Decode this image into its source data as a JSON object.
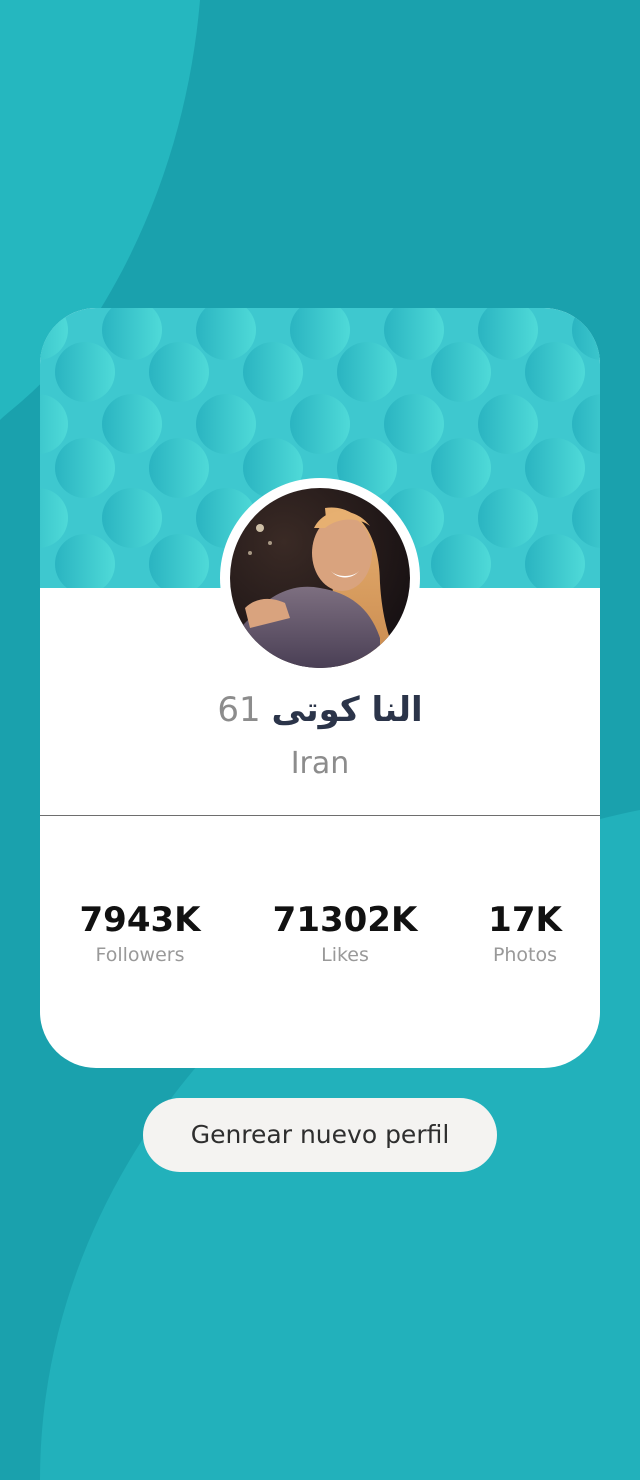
{
  "colors": {
    "background": "#1aa1ad",
    "accent_light": "#3ec8cf",
    "card": "#ffffff",
    "button": "#f4f3f1"
  },
  "profile": {
    "name": "النا کوتی",
    "age": "61",
    "country": "Iran"
  },
  "stats": [
    {
      "value": "7943K",
      "label": "Followers"
    },
    {
      "value": "71302K",
      "label": "Likes"
    },
    {
      "value": "17K",
      "label": "Photos"
    }
  ],
  "action": {
    "label": "Genrear nuevo perfil"
  },
  "icons": {
    "avatar": "profile-photo"
  }
}
